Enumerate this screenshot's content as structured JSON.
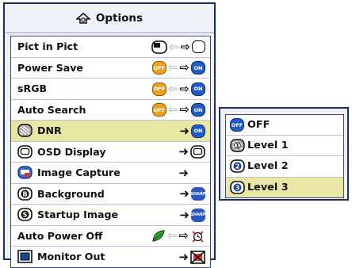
{
  "menu": {
    "title": "Options",
    "title_icon": "options-icon",
    "rows": [
      {
        "label": "Pict in Pict",
        "icon": "",
        "from": "picture-in-picture-icon",
        "to": "blank-icon"
      },
      {
        "label": "Power Save",
        "icon": "",
        "from": "off-badge",
        "to": "on-badge",
        "from_text": "OFF",
        "to_text": "ON"
      },
      {
        "label": "sRGB",
        "icon": "",
        "from": "off-badge",
        "to": "on-badge",
        "from_text": "OFF",
        "to_text": "ON"
      },
      {
        "label": "Auto Search",
        "icon": "",
        "from": "off-badge",
        "to": "on-badge",
        "from_text": "OFF",
        "to_text": "ON"
      },
      {
        "label": "DNR",
        "icon": "dnr-icon",
        "to": "on-badge",
        "to_text": "ON",
        "selected": true
      },
      {
        "label": "OSD Display",
        "icon": "osd-icon",
        "to": "osd-icon"
      },
      {
        "label": "Image Capture",
        "icon": "image-capture-icon",
        "to": ""
      },
      {
        "label": "Background",
        "icon": "background-icon",
        "to": "sharp-logo-badge",
        "to_text": "SHARP"
      },
      {
        "label": "Startup Image",
        "icon": "startup-image-icon",
        "to": "sharp-logo-badge",
        "to_text": "SHARP"
      },
      {
        "label": "Auto Power Off",
        "icon": "",
        "from": "leaf-icon",
        "to": "power-off-icon"
      },
      {
        "label": "Monitor Out",
        "icon": "monitor-out-icon",
        "to": "monitor-off-icon"
      }
    ]
  },
  "submenu": {
    "items": [
      {
        "label": "OFF",
        "icon": "off-badge",
        "icon_text": "OFF"
      },
      {
        "label": "Level 1",
        "icon": "level-1-icon"
      },
      {
        "label": "Level 2",
        "icon": "level-2-icon"
      },
      {
        "label": "Level 3",
        "icon": "level-3-icon",
        "selected": true
      }
    ]
  },
  "colors": {
    "frame": "#1b2d63",
    "highlight": "#e9e6a5",
    "accent_blue": "#1d5cc7",
    "accent_orange": "#f0a01a"
  }
}
